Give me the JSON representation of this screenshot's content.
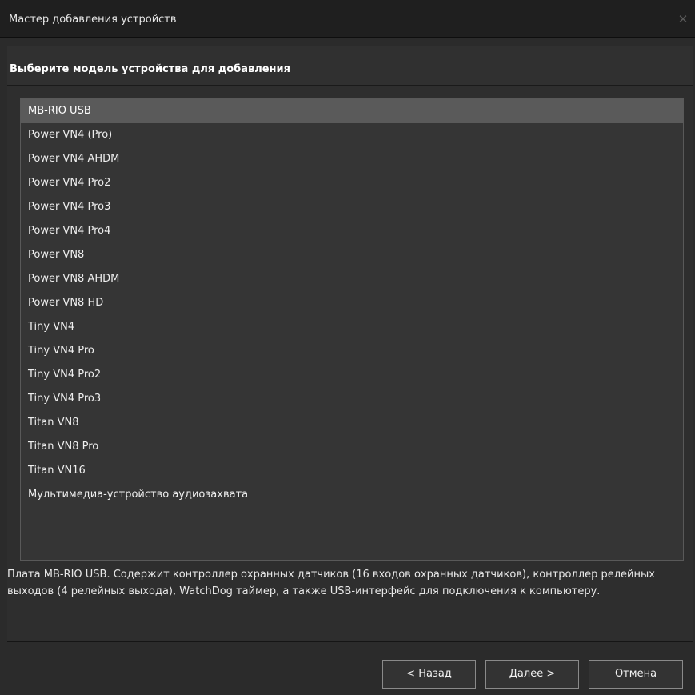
{
  "window": {
    "title": "Мастер добавления устройств",
    "close_glyph": "✕"
  },
  "header": {
    "text": "Выберите модель устройства для добавления"
  },
  "device_list": {
    "selected_index": 0,
    "items": [
      "MB-RIO USB",
      "Power VN4 (Pro)",
      "Power VN4 AHDM",
      "Power VN4 Pro2",
      "Power VN4 Pro3",
      "Power VN4 Pro4",
      "Power VN8",
      "Power VN8 AHDM",
      "Power VN8 HD",
      "Tiny VN4",
      "Tiny VN4 Pro",
      "Tiny VN4 Pro2",
      "Tiny VN4 Pro3",
      "Titan VN8",
      "Titan VN8 Pro",
      "Titan VN16",
      "Мультимедиа-устройство аудиозахвата"
    ]
  },
  "description": "Плата MB-RIO USB. Содержит контроллер охранных датчиков (16 входов охранных датчиков), контроллер релейных выходов (4 релейных выхода), WatchDog таймер, а также USB-интерфейс для подключения к компьютеру.",
  "buttons": {
    "back": "< Назад",
    "next": "Далее >",
    "cancel": "Отмена"
  },
  "colors": {
    "window_bg": "#2b2b2b",
    "titlebar_bg": "#1f1f1f",
    "list_bg": "#353535",
    "selected_bg": "#5a5a5a",
    "text": "#eeeeee"
  },
  "icons": {
    "close": "close-icon"
  }
}
